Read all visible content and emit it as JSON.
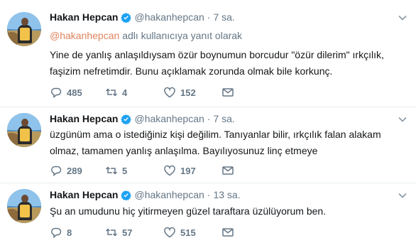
{
  "colors": {
    "text": "#14171a",
    "secondary": "#657786",
    "mention": "#e0845e",
    "verified": "#1da1f2",
    "border": "#e6ecf0"
  },
  "tweets": [
    {
      "name": "Hakan Hepcan",
      "handle": "@hakanhepcan",
      "separator": "·",
      "time": "7 sa.",
      "reply_mention": "@hakanhepcan",
      "reply_suffix": "adlı kullanıcıya yanıt olarak",
      "text": "Yine de yanlış anlaşıldıysam özür boynumun borcudur \"özür dilerim\" ırkçılık, faşizim nefretimdir. Bunu açıklamak zorunda olmak bile korkunç.",
      "replies": "485",
      "retweets": "4",
      "likes": "152"
    },
    {
      "name": "Hakan Hepcan",
      "handle": "@hakanhepcan",
      "separator": "·",
      "time": "7 sa.",
      "text": "üzgünüm ama o istediğiniz kişi değilim. Tanıyanlar bilir, ırkçılık falan alakam olmaz, tamamen yanlış anlaşılma. Bayılıyosunuz linç etmeye",
      "replies": "289",
      "retweets": "5",
      "likes": "197"
    },
    {
      "name": "Hakan Hepcan",
      "handle": "@hakanhepcan",
      "separator": "·",
      "time": "13 sa.",
      "text": "Şu an umudunu hiç yitirmeyen güzel taraftara üzülüyorum ben.",
      "replies": "8",
      "retweets": "57",
      "likes": "515"
    }
  ],
  "icons": {
    "verified": "verified-badge-icon",
    "chevron": "chevron-down-icon",
    "reply": "reply-icon",
    "retweet": "retweet-icon",
    "like": "heart-icon",
    "dm": "envelope-icon"
  }
}
